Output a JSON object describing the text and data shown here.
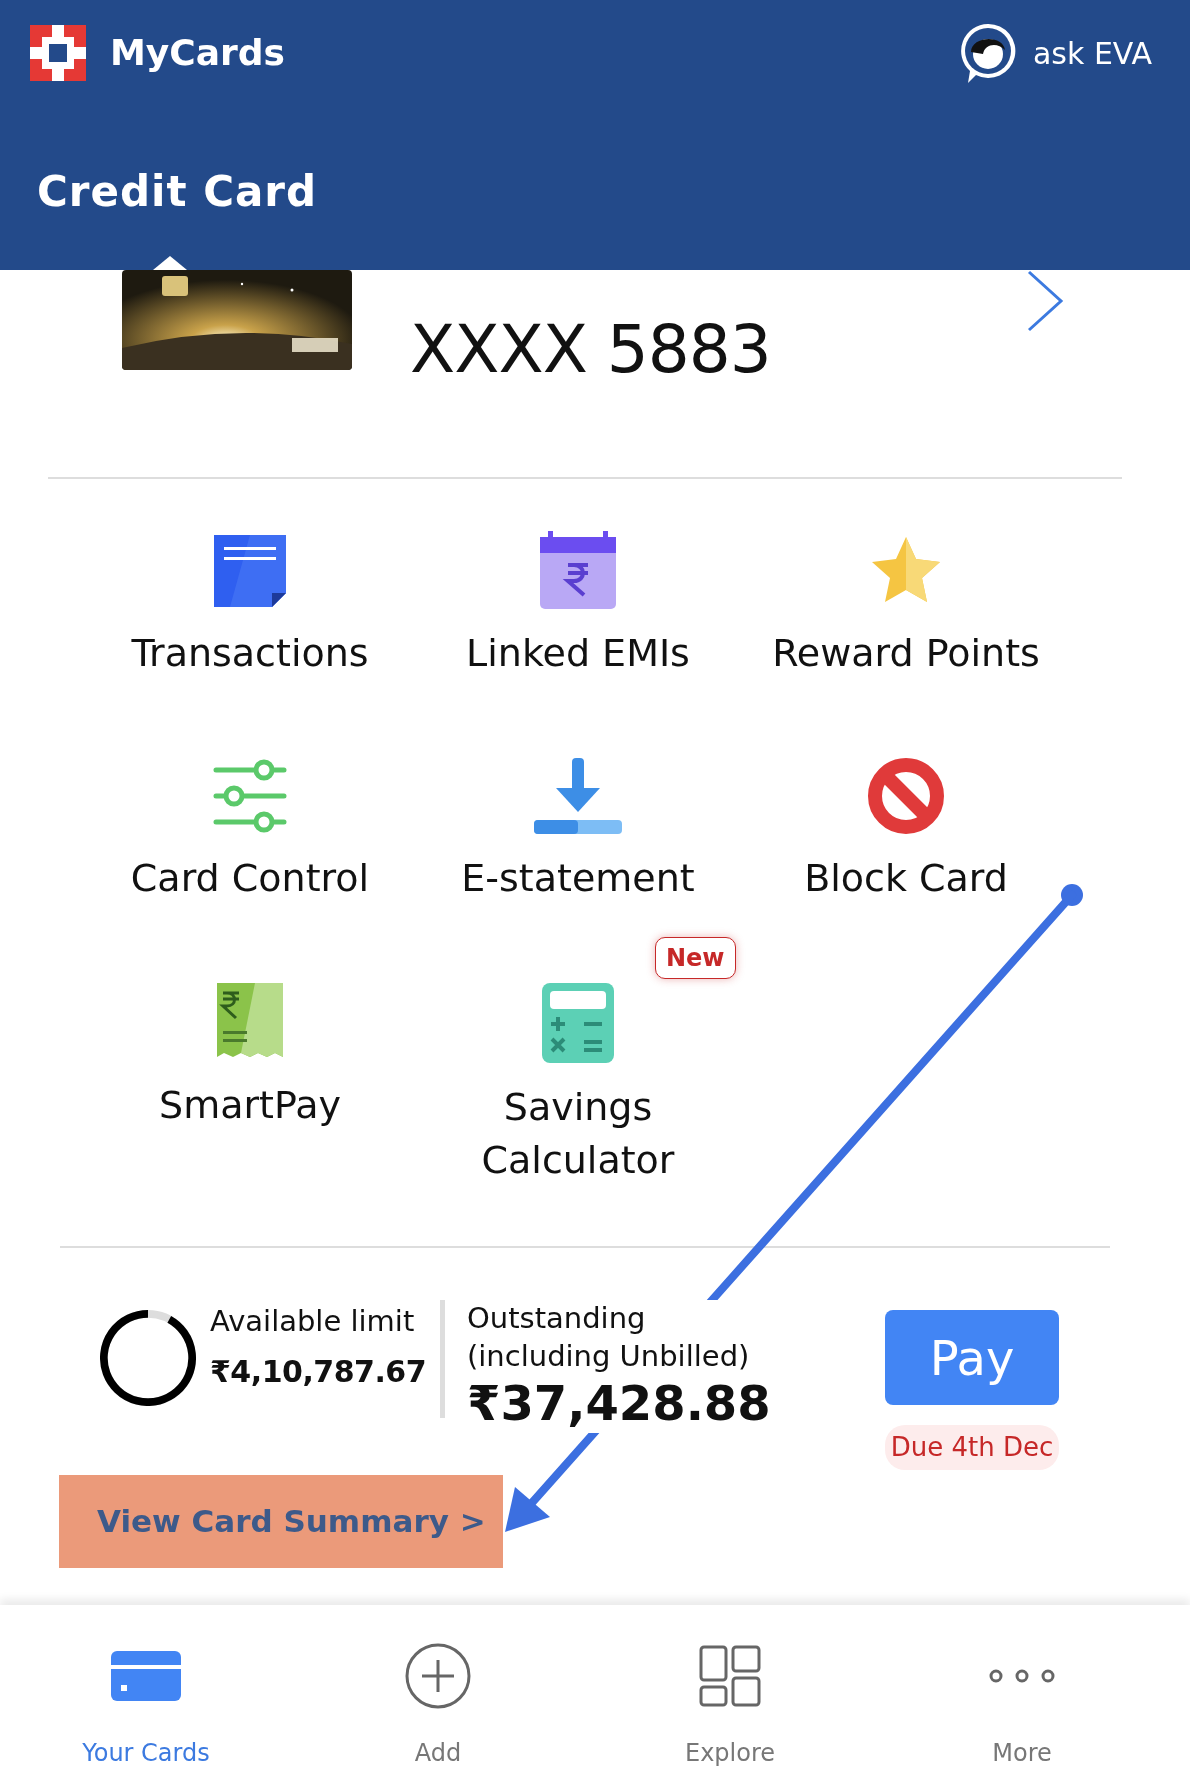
{
  "app": {
    "title": "MyCards",
    "assistant": "ask EVA"
  },
  "section_title": "Credit Card",
  "card": {
    "number": "XXXX 5883"
  },
  "actions": [
    {
      "label": "Transactions",
      "kind": "note"
    },
    {
      "label": "Linked EMIs",
      "kind": "calendar"
    },
    {
      "label": "Reward Points",
      "kind": "star"
    },
    {
      "label": "Card Control",
      "kind": "sliders"
    },
    {
      "label": "E-statement",
      "kind": "download"
    },
    {
      "label": "Block Card",
      "kind": "block"
    },
    {
      "label": "SmartPay",
      "kind": "receipt"
    },
    {
      "label": "Savings Calculator",
      "kind": "calculator",
      "badge": "New"
    }
  ],
  "summary": {
    "available_label": "Available limit",
    "available_amount": "₹4,10,787.67",
    "level": 0.92,
    "outstanding_label": "Outstanding (including Unbilled)",
    "outstanding_amount": "₹37,428.88",
    "pay": "Pay",
    "due": "Due 4th Dec"
  },
  "summary_link": "View Card Summary >",
  "nav": [
    {
      "label": "Your Cards",
      "kind": "card",
      "selected": true
    },
    {
      "label": "Add",
      "kind": "add",
      "selected": false
    },
    {
      "label": "Explore",
      "kind": "explore",
      "selected": false
    },
    {
      "label": "More",
      "kind": "more",
      "selected": false
    }
  ]
}
